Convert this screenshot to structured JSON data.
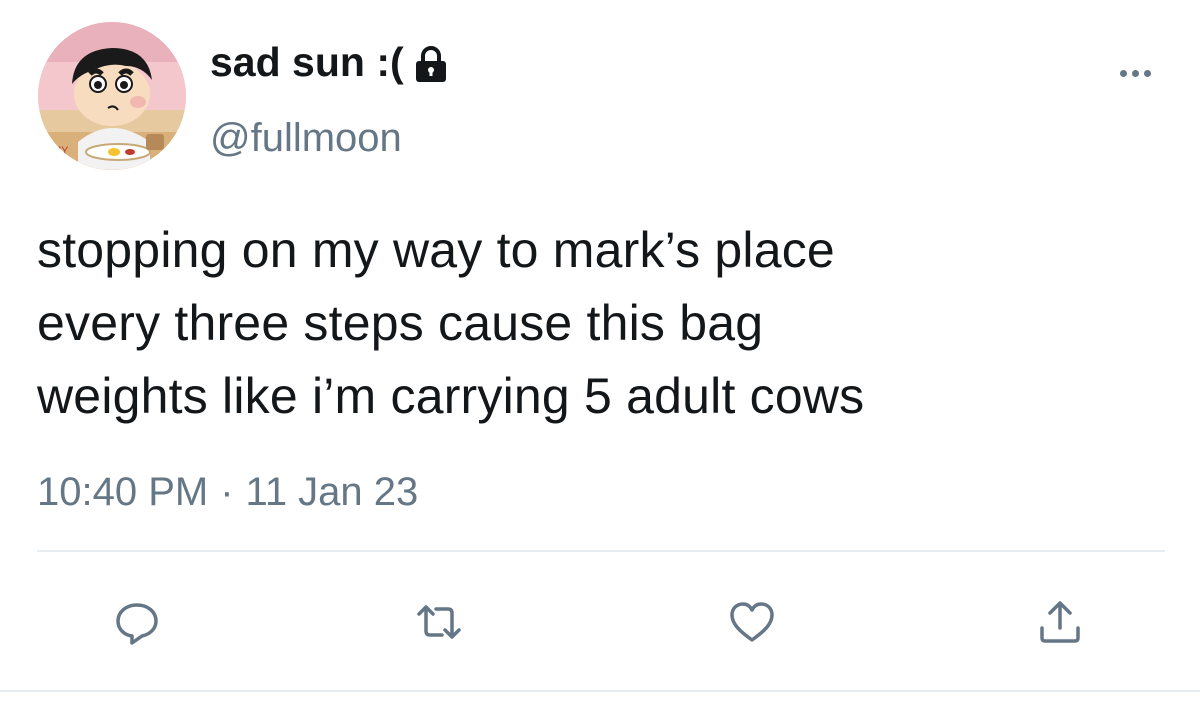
{
  "user": {
    "display_name": "sad sun :(",
    "handle": "@fullmoon",
    "protected": true,
    "avatar_icon": "cartoon-boy-avatar",
    "avatar_text": "MY"
  },
  "tweet": {
    "lines": [
      "stopping on my way to mark’s place",
      "every three steps cause this bag",
      "weights like i’m carrying 5 adult cows"
    ],
    "time": "10:40 PM",
    "separator": "·",
    "date": "11 Jan 23"
  },
  "actions": {
    "reply_icon": "reply-icon",
    "retweet_icon": "retweet-icon",
    "like_icon": "heart-icon",
    "share_icon": "share-icon",
    "more_icon": "more-dots-icon"
  },
  "colors": {
    "text": "#14171a",
    "secondary": "#657786",
    "divider": "#e6ecf0"
  }
}
